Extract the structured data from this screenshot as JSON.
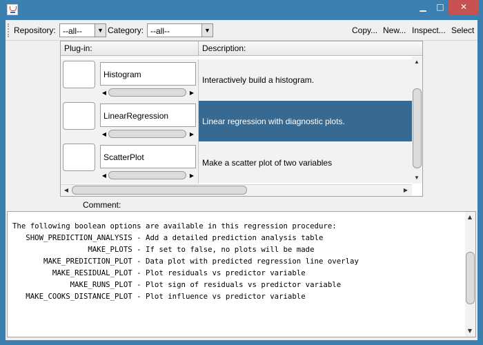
{
  "window": {
    "app_icon": "java-app-icon",
    "minimize_glyph": "▁",
    "maximize_glyph": "□",
    "close_glyph": "✕"
  },
  "toolbar": {
    "repository_label": "Repository:",
    "repository_value": "--all--",
    "category_label": "Category:",
    "category_value": "--all--",
    "copy_label": "Copy...",
    "new_label": "New...",
    "inspect_label": "Inspect...",
    "select_label": "Select"
  },
  "table": {
    "columns": [
      "Plug-in:",
      "Description:"
    ],
    "rows": [
      {
        "name": "Histogram",
        "description": "Interactively build a histogram.",
        "selected": false
      },
      {
        "name": "LinearRegression",
        "description": "Linear regression with diagnostic plots.",
        "selected": true
      },
      {
        "name": "ScatterPlot",
        "description": "Make a scatter plot of two variables",
        "selected": false
      }
    ]
  },
  "comment": {
    "label": "Comment:",
    "text": "The following boolean options are available in this regression procedure:\n   SHOW_PREDICTION_ANALYSIS - Add a detailed prediction analysis table\n                 MAKE_PLOTS - If set to false, no plots will be made\n       MAKE_PREDICTION_PLOT - Data plot with predicted regression line overlay\n         MAKE_RESIDUAL_PLOT - Plot residuals vs predictor variable\n             MAKE_RUNS_PLOT - Plot sign of residuals vs predictor variable\n   MAKE_COOKS_DISTANCE_PLOT - Plot influence vs predictor variable"
  },
  "colors": {
    "title_bar": "#3c7fb1",
    "close_button": "#c75050",
    "selection": "#386a91"
  }
}
